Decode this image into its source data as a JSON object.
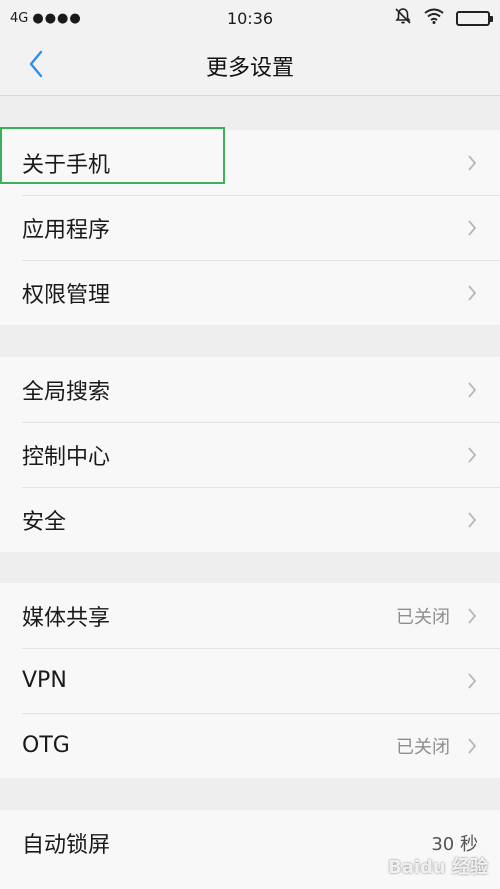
{
  "status_bar": {
    "network": "4G",
    "signal": "●●●●",
    "time": "10:36"
  },
  "nav": {
    "title": "更多设置"
  },
  "groups": [
    {
      "items": [
        {
          "label": "关于手机",
          "value": ""
        },
        {
          "label": "应用程序",
          "value": ""
        },
        {
          "label": "权限管理",
          "value": ""
        }
      ]
    },
    {
      "items": [
        {
          "label": "全局搜索",
          "value": ""
        },
        {
          "label": "控制中心",
          "value": ""
        },
        {
          "label": "安全",
          "value": ""
        }
      ]
    },
    {
      "items": [
        {
          "label": "媒体共享",
          "value": "已关闭"
        },
        {
          "label": "VPN",
          "value": ""
        },
        {
          "label": "OTG",
          "value": "已关闭"
        }
      ]
    },
    {
      "items": [
        {
          "label": "自动锁屏",
          "value": "30 秒"
        }
      ]
    }
  ],
  "watermark": "Baidu 经验",
  "colors": {
    "accent": "#2c8ff0",
    "highlight": "#3cb15a",
    "chevron": "#b8b8b8"
  },
  "icons": [
    "back-arrow-icon",
    "bell-off-icon",
    "wifi-icon",
    "battery-icon",
    "chevron-right-icon"
  ]
}
